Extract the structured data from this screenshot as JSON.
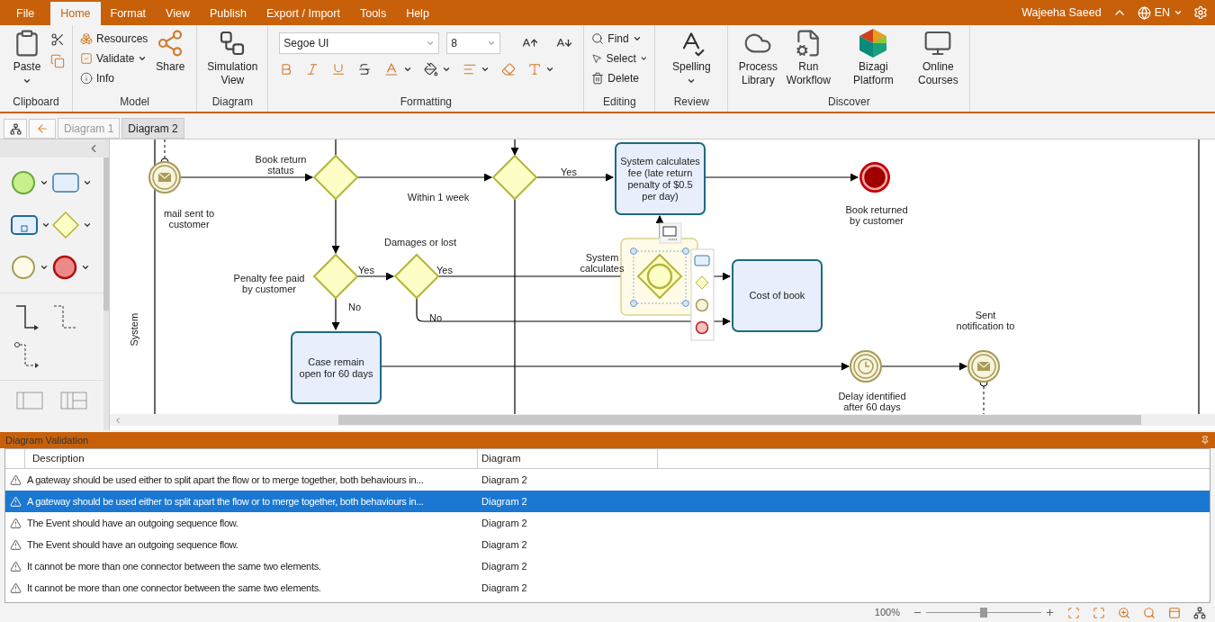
{
  "menu": {
    "tabs": [
      {
        "label": "File",
        "selected": false
      },
      {
        "label": "Home",
        "selected": true
      },
      {
        "label": "Format",
        "selected": false
      },
      {
        "label": "View",
        "selected": false
      },
      {
        "label": "Publish",
        "selected": false
      },
      {
        "label": "Export / Import",
        "selected": false
      },
      {
        "label": "Tools",
        "selected": false
      },
      {
        "label": "Help",
        "selected": false
      }
    ],
    "user": "Wajeeha Saeed",
    "language": "EN"
  },
  "ribbon": [
    {
      "title": "Clipboard",
      "items": [
        "Paste"
      ]
    },
    {
      "title": "Model",
      "items": [
        "Resources",
        "Validate",
        "Info",
        "Share"
      ]
    },
    {
      "title": "Diagram",
      "items": [
        "Simulation View"
      ]
    },
    {
      "title": "Formatting",
      "font": "Segoe UI",
      "size": "8"
    },
    {
      "title": "Editing",
      "items": [
        "Find",
        "Select",
        "Delete"
      ]
    },
    {
      "title": "Review",
      "items": [
        "Spelling"
      ]
    },
    {
      "title": "Discover",
      "items": [
        "Process Library",
        "Run Workflow",
        "Bizagi Platform",
        "Online Courses"
      ]
    }
  ],
  "diagram_tabs": [
    {
      "label": "Diagram 1",
      "selected": false
    },
    {
      "label": "Diagram 2",
      "selected": true
    }
  ],
  "diagram": {
    "lane": "System",
    "tasks": [
      "System calculates fee (late return penalty of $0.5 per day)",
      "Cost of book",
      "Case remain open for 60 days"
    ],
    "events": [
      {
        "kind": "message",
        "label": "mail sent to customer"
      },
      {
        "kind": "end",
        "label": "Book returned by customer"
      },
      {
        "kind": "message",
        "label": "Sent notification to"
      },
      {
        "kind": "timer",
        "label": "Delay identified after 60 days"
      }
    ],
    "flow_labels": [
      "Book return status",
      "Within 1 week",
      "Yes",
      "Damages or lost",
      "Penalty fee paid by customer",
      "Yes",
      "Yes",
      "System calculates",
      "No",
      "No"
    ]
  },
  "validation": {
    "title": "Diagram Validation",
    "columns": [
      "Description",
      "Diagram"
    ],
    "rows": [
      {
        "description": "A gateway should be used either to split apart the flow or to merge together, both behaviours in...",
        "diagram": "Diagram 2",
        "selected": false
      },
      {
        "description": "A gateway should be used either to split apart the flow or to merge together, both behaviours in...",
        "diagram": "Diagram 2",
        "selected": true
      },
      {
        "description": "The Event should have an outgoing sequence flow.",
        "diagram": "Diagram 2",
        "selected": false
      },
      {
        "description": "The Event should have an outgoing sequence flow.",
        "diagram": "Diagram 2",
        "selected": false
      },
      {
        "description": "It cannot be more than one connector between the same two elements.",
        "diagram": "Diagram 2",
        "selected": false
      },
      {
        "description": "It cannot be more than one connector between the same two elements.",
        "diagram": "Diagram 2",
        "selected": false
      }
    ]
  },
  "status": {
    "zoom": "100%",
    "level": 0.5
  }
}
